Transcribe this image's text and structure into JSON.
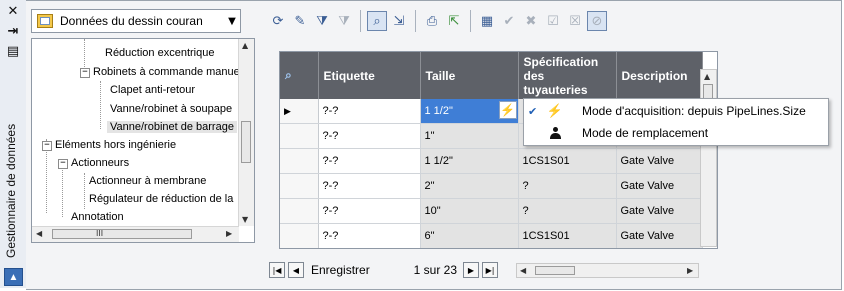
{
  "window": {
    "vertical_title": "Gestionnaire de données",
    "close_icon": "✕",
    "autohide_icon": "⇥",
    "properties_icon": "▤"
  },
  "source_dropdown": {
    "selected": "Données du dessin couran"
  },
  "toolbar": {
    "icons": [
      "refresh-icon",
      "edit-icon",
      "filter-icon",
      "clear-filter-icon",
      "zoom-icon",
      "export-icon",
      "print-icon",
      "import-icon",
      "sheet-icon",
      "accept-icon",
      "reject-icon",
      "accept-all-icon",
      "reject-all-icon",
      "disabled-icon"
    ]
  },
  "tree": {
    "items": [
      {
        "label": "Réduction excentrique",
        "level": 3
      },
      {
        "label": "Robinets à commande manuel",
        "level": 2,
        "expander": "−"
      },
      {
        "label": "Clapet anti-retour",
        "level": 3
      },
      {
        "label": "Vanne/robinet à soupape",
        "level": 3
      },
      {
        "label": "Vanne/robinet de barrage",
        "level": 3,
        "selected": true
      },
      {
        "label": "Eléments hors ingénierie",
        "level": 0,
        "expander": "−"
      },
      {
        "label": "Actionneurs",
        "level": 1,
        "expander": "−"
      },
      {
        "label": "Actionneur à membrane",
        "level": 2
      },
      {
        "label": "Régulateur de réduction de la",
        "level": 2
      },
      {
        "label": "Annotation",
        "level": 1
      }
    ],
    "scroll_thumb": "III"
  },
  "grid": {
    "columns": [
      "",
      "Etiquette",
      "Taille",
      "Spécification des tuyauteries",
      "Description"
    ],
    "rows": [
      {
        "tag": "?-?",
        "size": "1 1/2\"",
        "spec": "",
        "desc": "",
        "current": true
      },
      {
        "tag": "?-?",
        "size": "1\"",
        "spec": "",
        "desc": ""
      },
      {
        "tag": "?-?",
        "size": "1 1/2\"",
        "spec": "1CS1S01",
        "desc": "Gate Valve"
      },
      {
        "tag": "?-?",
        "size": "2\"",
        "spec": "?",
        "desc": "Gate Valve"
      },
      {
        "tag": "?-?",
        "size": "10\"",
        "spec": "?",
        "desc": "Gate Valve"
      },
      {
        "tag": "?-?",
        "size": "6\"",
        "spec": "1CS1S01",
        "desc": "Gate Valve"
      }
    ]
  },
  "context_menu": {
    "items": [
      {
        "label": "Mode d'acquisition: depuis PipeLines.Size",
        "checked": true,
        "icon": "lightning-icon"
      },
      {
        "label": "Mode de remplacement",
        "checked": false,
        "icon": "person-icon"
      }
    ]
  },
  "navigator": {
    "label": "Enregistrer",
    "position": "1 sur 23",
    "first": "|◀",
    "prev": "◀",
    "next": "▶",
    "last": "▶|"
  }
}
